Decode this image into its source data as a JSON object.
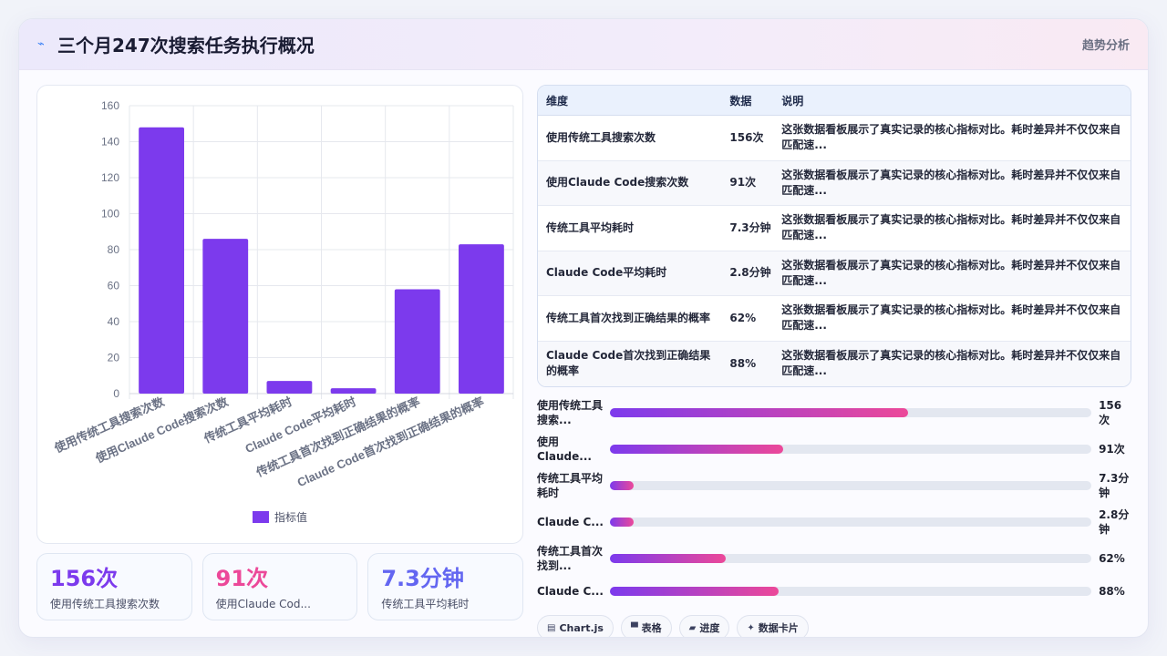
{
  "header": {
    "icon": "sparkline-icon",
    "title": "三个月247次搜索任务执行概况",
    "link_label": "趋势分析"
  },
  "chart_data": {
    "type": "bar",
    "categories": [
      "使用传统工具搜索次数",
      "使用Claude Code搜索次数",
      "传统工具平均耗时",
      "Claude Code平均耗时",
      "传统工具首次找到正确结果的概率",
      "Claude Code首次找到正确结果的概率"
    ],
    "series": [
      {
        "name": "指标值",
        "values": [
          148,
          86,
          7,
          3,
          58,
          83
        ],
        "color": "#7c3aed"
      }
    ],
    "ylim": [
      0,
      160
    ],
    "yticks": [
      0,
      20,
      40,
      60,
      80,
      100,
      120,
      140,
      160
    ],
    "grid": true,
    "legend": "bottom"
  },
  "kpis": [
    {
      "value": "156次",
      "label": "使用传统工具搜索次数",
      "color": "#7c3aed"
    },
    {
      "value": "91次",
      "label": "使用Claude Cod...",
      "color": "#ec4899"
    },
    {
      "value": "7.3分钟",
      "label": "传统工具平均耗时",
      "color": "#6366f1"
    }
  ],
  "table": {
    "headers": [
      "维度",
      "数据",
      "说明"
    ],
    "rows": [
      [
        "使用传统工具搜索次数",
        "156次",
        "这张数据看板展示了真实记录的核心指标对比。耗时差异并不仅仅来自匹配速..."
      ],
      [
        "使用Claude Code搜索次数",
        "91次",
        "这张数据看板展示了真实记录的核心指标对比。耗时差异并不仅仅来自匹配速..."
      ],
      [
        "传统工具平均耗时",
        "7.3分钟",
        "这张数据看板展示了真实记录的核心指标对比。耗时差异并不仅仅来自匹配速..."
      ],
      [
        "Claude Code平均耗时",
        "2.8分钟",
        "这张数据看板展示了真实记录的核心指标对比。耗时差异并不仅仅来自匹配速..."
      ],
      [
        "传统工具首次找到正确结果的概率",
        "62%",
        "这张数据看板展示了真实记录的核心指标对比。耗时差异并不仅仅来自匹配速..."
      ],
      [
        "Claude Code首次找到正确结果的概率",
        "88%",
        "这张数据看板展示了真实记录的核心指标对比。耗时差异并不仅仅来自匹配速..."
      ]
    ]
  },
  "progress": [
    {
      "label": "使用传统工具搜索...",
      "value": "156次",
      "fraction": 0.62
    },
    {
      "label": "使用Claude...",
      "value": "91次",
      "fraction": 0.36
    },
    {
      "label": "传统工具平均耗时",
      "value": "7.3分钟",
      "fraction": 0.05
    },
    {
      "label": "Claude C...",
      "value": "2.8分钟",
      "fraction": 0.05
    },
    {
      "label": "传统工具首次找到...",
      "value": "62%",
      "fraction": 0.24
    },
    {
      "label": "Claude C...",
      "value": "88%",
      "fraction": 0.35
    }
  ],
  "chips": [
    {
      "icon": "chart-icon",
      "glyph": "▤",
      "label": "Chart.js"
    },
    {
      "icon": "table-icon",
      "glyph": "▀",
      "label": "表格"
    },
    {
      "icon": "progress-icon",
      "glyph": "▰",
      "label": "进度"
    },
    {
      "icon": "card-icon",
      "glyph": "✦",
      "label": "数据卡片"
    }
  ]
}
